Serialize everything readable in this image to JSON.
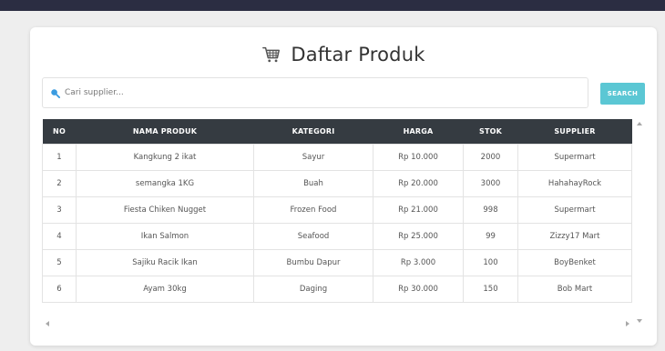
{
  "page": {
    "title": "Daftar Produk",
    "title_icon": "shopping-cart-icon"
  },
  "search": {
    "placeholder": "Cari supplier...",
    "value": "",
    "button_label": "SEARCH",
    "button_color": "#5bc7d4"
  },
  "table": {
    "header_color": "#353b41",
    "columns": [
      "NO",
      "NAMA PRODUK",
      "KATEGORI",
      "HARGA",
      "STOK",
      "SUPPLIER"
    ],
    "rows": [
      [
        "1",
        "Kangkung 2 ikat",
        "Sayur",
        "Rp 10.000",
        "2000",
        "Supermart"
      ],
      [
        "2",
        "semangka 1KG",
        "Buah",
        "Rp 20.000",
        "3000",
        "HahahayRock"
      ],
      [
        "3",
        "Fiesta Chiken Nugget",
        "Frozen Food",
        "Rp 21.000",
        "998",
        "Supermart"
      ],
      [
        "4",
        "Ikan Salmon",
        "Seafood",
        "Rp 25.000",
        "99",
        "Zizzy17 Mart"
      ],
      [
        "5",
        "Sajiku Racik Ikan",
        "Bumbu Dapur",
        "Rp 3.000",
        "100",
        "BoyBenket"
      ],
      [
        "6",
        "Ayam 30kg",
        "Daging",
        "Rp 30.000",
        "150",
        "Bob Mart"
      ]
    ]
  }
}
